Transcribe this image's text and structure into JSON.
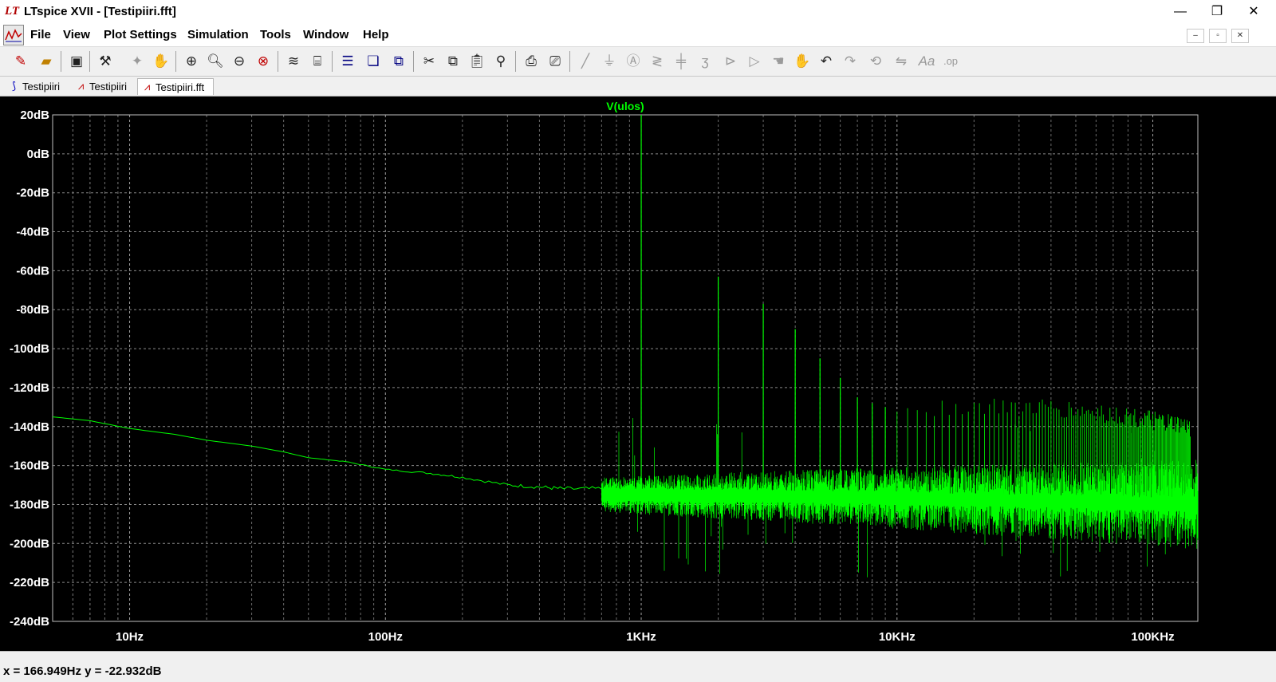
{
  "window": {
    "title": "LTspice XVII - [Testipiiri.fft]",
    "minimize": "—",
    "maximize": "❐",
    "close": "✕"
  },
  "menu": {
    "items": [
      "File",
      "View",
      "Plot Settings",
      "Simulation",
      "Tools",
      "Window",
      "Help"
    ],
    "mdi_minimize": "–",
    "mdi_restore": "▫",
    "mdi_close": "✕"
  },
  "toolbar": {
    "icons": [
      "new-schematic-icon",
      "open-icon",
      "save-icon",
      "control-panel-icon",
      "run-icon",
      "halt-icon",
      "zoom-area-icon",
      "zoom-in-icon",
      "zoom-out-icon",
      "zoom-fit-icon",
      "autorange-icon",
      "cursor-icon",
      "tile-horizontal-icon",
      "cascade-icon",
      "tile-vertical-icon",
      "cut-icon",
      "copy-icon",
      "paste-icon",
      "find-icon",
      "print-icon",
      "print-setup-icon",
      "wire-icon",
      "ground-icon",
      "label-icon",
      "resistor-icon",
      "capacitor-icon",
      "inductor-icon",
      "diode-icon",
      "component-icon",
      "move-icon",
      "drag-icon",
      "undo-icon",
      "redo-icon",
      "rotate-icon",
      "mirror-icon",
      "text-icon",
      "spice-directive-icon"
    ]
  },
  "tabs": [
    {
      "label": "Testipiiri",
      "icon": "schematic-icon",
      "active": false
    },
    {
      "label": "Testipiiri",
      "icon": "waveform-icon",
      "active": false
    },
    {
      "label": "Testipiiri.fft",
      "icon": "waveform-icon",
      "active": true
    }
  ],
  "status": {
    "text": "x = 166.949Hz   y = -22.932dB"
  },
  "colors": {
    "trace": "#00ff00",
    "background": "#000000",
    "grid": "#a0a0a0",
    "axis_text": "#ffffff"
  },
  "chart_data": {
    "type": "line",
    "title": "V(ulos)",
    "xscale": "log",
    "xlim": [
      5,
      150000
    ],
    "ylim": [
      -240,
      20
    ],
    "x_ticks": [
      {
        "value": 10,
        "label": "10Hz"
      },
      {
        "value": 100,
        "label": "100Hz"
      },
      {
        "value": 1000,
        "label": "1KHz"
      },
      {
        "value": 10000,
        "label": "10KHz"
      },
      {
        "value": 100000,
        "label": "100KHz"
      }
    ],
    "y_ticks": [
      {
        "value": 20,
        "label": "20dB"
      },
      {
        "value": 0,
        "label": "0dB"
      },
      {
        "value": -20,
        "label": "-20dB"
      },
      {
        "value": -40,
        "label": "-40dB"
      },
      {
        "value": -60,
        "label": "-60dB"
      },
      {
        "value": -80,
        "label": "-80dB"
      },
      {
        "value": -100,
        "label": "-100dB"
      },
      {
        "value": -120,
        "label": "-120dB"
      },
      {
        "value": -140,
        "label": "-140dB"
      },
      {
        "value": -160,
        "label": "-160dB"
      },
      {
        "value": -180,
        "label": "-180dB"
      },
      {
        "value": -200,
        "label": "-200dB"
      },
      {
        "value": -220,
        "label": "-220dB"
      },
      {
        "value": -240,
        "label": "-240dB"
      }
    ],
    "grid": true,
    "series": [
      {
        "name": "V(ulos)",
        "color": "#00ff00",
        "x": [
          5,
          7,
          10,
          15,
          20,
          30,
          40,
          50,
          70,
          100,
          150,
          200,
          300,
          400,
          500,
          700
        ],
        "y": [
          -135,
          -137,
          -141,
          -144,
          -147,
          -150,
          -153,
          -156,
          -158,
          -162,
          -164,
          -166,
          -170,
          -171,
          -172,
          -172
        ]
      }
    ],
    "noise_floor_db": [
      {
        "x": 700,
        "y": -175
      },
      {
        "x": 5000,
        "y": -176
      },
      {
        "x": 150000,
        "y": -180
      }
    ],
    "peaks": [
      {
        "x": 1000,
        "y": 20
      },
      {
        "x": 2000,
        "y": -63
      },
      {
        "x": 3000,
        "y": -77
      },
      {
        "x": 4000,
        "y": -90
      },
      {
        "x": 5000,
        "y": -105
      },
      {
        "x": 6000,
        "y": -115
      },
      {
        "x": 7000,
        "y": -125
      },
      {
        "x": 8000,
        "y": -128
      },
      {
        "x": 9000,
        "y": -130
      }
    ]
  }
}
